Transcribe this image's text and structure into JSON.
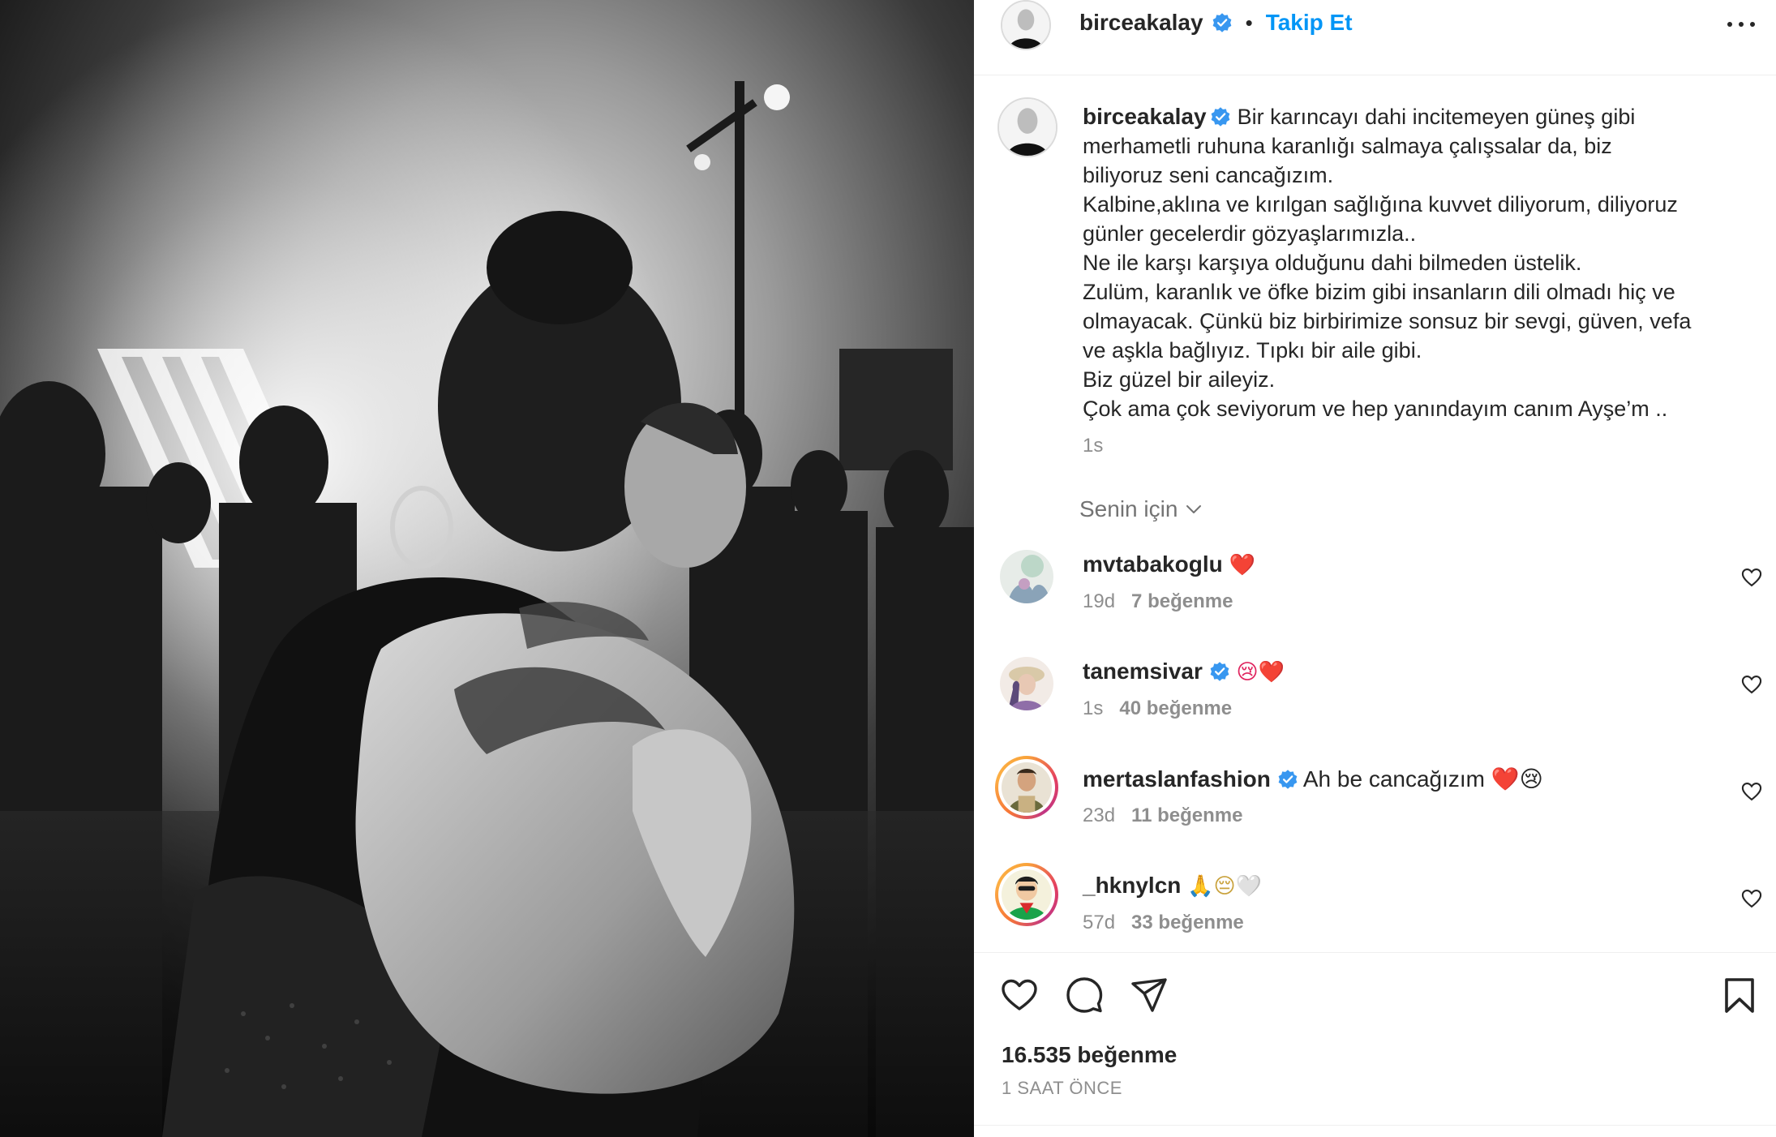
{
  "post": {
    "author": "birceakalay",
    "verified": true,
    "follow_label": "Takip Et",
    "separator": "•",
    "caption_lines": [
      "Bir karıncayı dahi incitemeyen güneş gibi",
      "merhametli ruhuna karanlığı salmaya çalışsalar da, biz",
      "biliyoruz seni cancağızım.",
      "Kalbine,aklına ve kırılgan sağlığına kuvvet diliyorum, diliyoruz",
      "günler gecelerdir gözyaşlarımızla..",
      "Ne ile karşı karşıya olduğunu dahi bilmeden üstelik.",
      "Zulüm, karanlık ve öfke bizim gibi insanların dili olmadı hiç ve",
      "olmayacak. Çünkü biz birbirimize sonsuz bir sevgi, güven, vefa",
      "ve aşkla bağlıyız. Tıpkı bir aile gibi.",
      "Biz güzel bir aileyiz.",
      "Çok ama çok seviyorum ve hep yanındayım canım Ayşe’m .."
    ],
    "caption_time": "1s",
    "for_you_label": "Senin için",
    "likes_label": "16.535 beğenme",
    "posted_ago": "1 SAAT ÖNCE"
  },
  "comments": [
    {
      "user": "mvtabakoglu",
      "verified": false,
      "text": "❤️",
      "time": "19d",
      "likes": "7 beğenme",
      "story_ring": false
    },
    {
      "user": "tanemsivar",
      "verified": true,
      "text": "😢❤️",
      "time": "1s",
      "likes": "40 beğenme",
      "story_ring": false
    },
    {
      "user": "mertaslanfashion",
      "verified": true,
      "text": "Ah be cancağızım ❤️😢",
      "time": "23d",
      "likes": "11 beğenme",
      "story_ring": true
    },
    {
      "user": "_hknylcn",
      "verified": false,
      "text": "🙏😔🤍",
      "time": "57d",
      "likes": "33 beğenme",
      "story_ring": true
    }
  ],
  "icons": {
    "like": "heart-icon",
    "comment": "comment-bubble-icon",
    "share": "paper-plane-icon",
    "save": "bookmark-icon",
    "more": "more-dots-icon",
    "verified": "verified-badge-icon",
    "chevron": "chevron-down-icon"
  },
  "colors": {
    "accent": "#0095f6",
    "verified": "#3897f0",
    "secondary_text": "#8e8e8e",
    "primary_text": "#262626"
  }
}
